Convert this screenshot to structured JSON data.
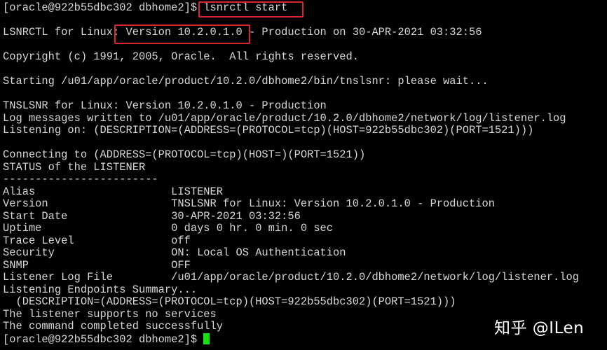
{
  "terminal": {
    "lines": [
      "[oracle@922b55dbc302 dbhome2]$ lsnrctl start",
      "",
      "LSNRCTL for Linux: Version 10.2.0.1.0 - Production on 30-APR-2021 03:32:56",
      "",
      "Copyright (c) 1991, 2005, Oracle.  All rights reserved.",
      "",
      "Starting /u01/app/oracle/product/10.2.0/dbhome2/bin/tnslsnr: please wait...",
      "",
      "TNSLSNR for Linux: Version 10.2.0.1.0 - Production",
      "Log messages written to /u01/app/oracle/product/10.2.0/dbhome2/network/log/listener.log",
      "Listening on: (DESCRIPTION=(ADDRESS=(PROTOCOL=tcp)(HOST=922b55dbc302)(PORT=1521)))",
      "",
      "Connecting to (ADDRESS=(PROTOCOL=tcp)(HOST=)(PORT=1521))",
      "STATUS of the LISTENER",
      "------------------------",
      "Alias                     LISTENER",
      "Version                   TNSLSNR for Linux: Version 10.2.0.1.0 - Production",
      "Start Date                30-APR-2021 03:32:56",
      "Uptime                    0 days 0 hr. 0 min. 0 sec",
      "Trace Level               off",
      "Security                  ON: Local OS Authentication",
      "SNMP                      OFF",
      "Listener Log File         /u01/app/oracle/product/10.2.0/dbhome2/network/log/listener.log",
      "Listening Endpoints Summary...",
      "  (DESCRIPTION=(ADDRESS=(PROTOCOL=tcp)(HOST=922b55dbc302)(PORT=1521)))",
      "The listener supports no services",
      "The command completed successfully",
      "[oracle@922b55dbc302 dbhome2]$ "
    ],
    "cursor_color": "#16e016",
    "highlight_color": "#d9262b"
  },
  "watermark": "知乎 @ILen"
}
